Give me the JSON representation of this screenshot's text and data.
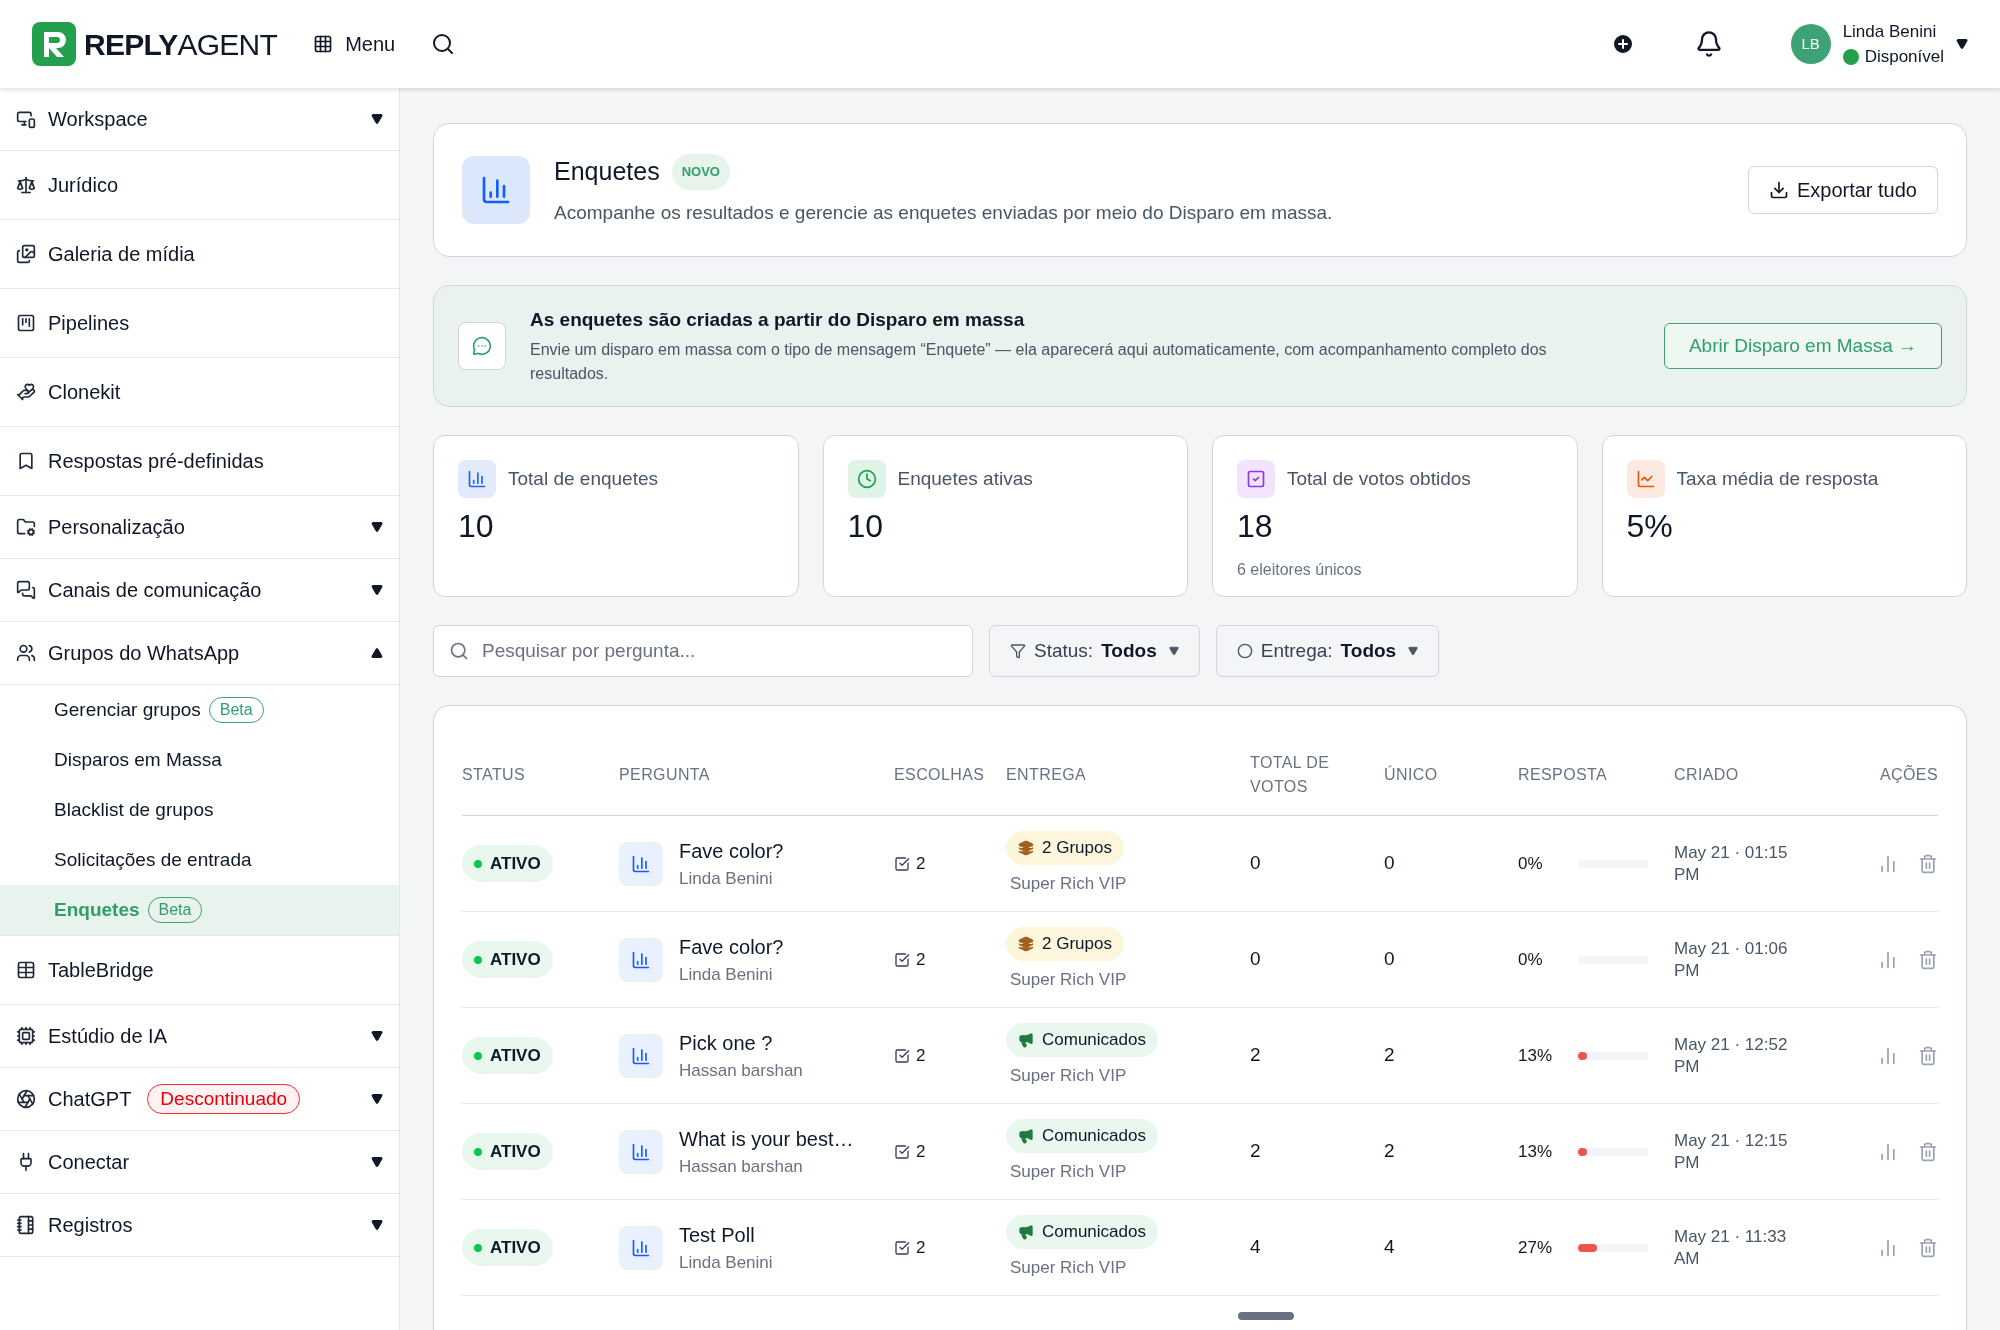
{
  "topbar": {
    "logo_bold": "REPLY",
    "logo_light": "AGENT",
    "menu_label": "Menu",
    "user": {
      "initials": "LB",
      "name": "Linda Benini",
      "status": "Disponível",
      "online": true
    }
  },
  "sidebar": {
    "items": [
      {
        "label": "Workspace",
        "kind": "expandable",
        "expanded": false
      },
      {
        "label": "Jurídico",
        "kind": "item"
      },
      {
        "label": "Galeria de mídia",
        "kind": "item"
      },
      {
        "label": "Pipelines",
        "kind": "item"
      },
      {
        "label": "Clonekit",
        "kind": "item"
      },
      {
        "label": "Respostas pré-definidas",
        "kind": "item"
      },
      {
        "label": "Personalização",
        "kind": "expandable",
        "expanded": false
      },
      {
        "label": "Canais de comunicação",
        "kind": "expandable",
        "expanded": false
      },
      {
        "label": "Grupos do WhatsApp",
        "kind": "expandable",
        "expanded": true,
        "children": [
          {
            "label": "Gerenciar grupos",
            "badge": "Beta",
            "selected": false
          },
          {
            "label": "Disparos em Massa",
            "selected": false
          },
          {
            "label": "Blacklist de grupos",
            "selected": false
          },
          {
            "label": "Solicitações de entrada",
            "selected": false
          },
          {
            "label": "Enquetes",
            "badge": "Beta",
            "selected": true
          }
        ]
      },
      {
        "label": "TableBridge",
        "kind": "item"
      },
      {
        "label": "Estúdio de IA",
        "kind": "expandable",
        "expanded": false
      },
      {
        "label": "ChatGPT",
        "kind": "expandable",
        "expanded": false,
        "badge": "Descontinuado"
      },
      {
        "label": "Conectar",
        "kind": "expandable",
        "expanded": false
      },
      {
        "label": "Registros",
        "kind": "expandable",
        "expanded": false
      }
    ]
  },
  "page_header": {
    "title": "Enquetes",
    "badge": "NOVO",
    "subtitle": "Acompanhe os resultados e gerencie as enquetes enviadas por meio do Disparo em massa.",
    "export_button": "Exportar tudo"
  },
  "info_banner": {
    "title": "As enquetes são criadas a partir do Disparo em massa",
    "text": "Envie um disparo em massa com o tipo de mensagem “Enquete” — ela aparecerá aqui automaticamente, com acompanhamento completo dos resultados.",
    "button": "Abrir Disparo em Massa →"
  },
  "stats": [
    {
      "label": "Total de enquetes",
      "value": "10",
      "color": "#2563eb"
    },
    {
      "label": "Enquetes ativas",
      "value": "10",
      "color": "#16a34a"
    },
    {
      "label": "Total de votos obtidos",
      "value": "18",
      "note": "6 eleitores únicos",
      "color": "#9333ea"
    },
    {
      "label": "Taxa média de resposta",
      "value": "5%",
      "color": "#ea580c"
    }
  ],
  "filters": {
    "search": {
      "placeholder": "Pesquisar por pergunta..."
    },
    "status": {
      "label": "Status:",
      "value": "Todos"
    },
    "delivery": {
      "label": "Entrega:",
      "value": "Todos"
    }
  },
  "table": {
    "columns": [
      "STATUS",
      "PERGUNTA",
      "ESCOLHAS",
      "ENTREGA",
      "TOTAL DE VOTOS",
      "ÚNICO",
      "RESPOSTA",
      "CRIADO",
      "AÇÕES"
    ],
    "rows": [
      {
        "status": "ATIVO",
        "question": "Fave color?",
        "author": "Linda Benini",
        "choices": "2",
        "delivery": {
          "kind": "groups",
          "label": "2 Grupos"
        },
        "target": "Super Rich VIP",
        "votes": "0",
        "unique": "0",
        "response": "0%",
        "level": 0,
        "created": "May 21 · 01:15 PM"
      },
      {
        "status": "ATIVO",
        "question": "Fave color?",
        "author": "Linda Benini",
        "choices": "2",
        "delivery": {
          "kind": "groups",
          "label": "2 Grupos"
        },
        "target": "Super Rich VIP",
        "votes": "0",
        "unique": "0",
        "response": "0%",
        "level": 0,
        "created": "May 21 · 01:06 PM"
      },
      {
        "status": "ATIVO",
        "question": "Pick one ?",
        "author": "Hassan barshan",
        "choices": "2",
        "delivery": {
          "kind": "announcements",
          "label": "Comunicados"
        },
        "target": "Super Rich VIP",
        "votes": "2",
        "unique": "2",
        "response": "13%",
        "level": 0.13,
        "created": "May 21 · 12:52 PM"
      },
      {
        "status": "ATIVO",
        "question": "What is your best…",
        "author": "Hassan barshan",
        "choices": "2",
        "delivery": {
          "kind": "announcements",
          "label": "Comunicados"
        },
        "target": "Super Rich VIP",
        "votes": "2",
        "unique": "2",
        "response": "13%",
        "level": 0.13,
        "created": "May 21 · 12:15 PM"
      },
      {
        "status": "ATIVO",
        "question": "Test Poll",
        "author": "Linda Benini",
        "choices": "2",
        "delivery": {
          "kind": "announcements",
          "label": "Comunicados"
        },
        "target": "Super Rich VIP",
        "votes": "4",
        "unique": "4",
        "response": "27%",
        "level": 0.27,
        "created": "May 21 · 11:33 AM"
      }
    ]
  }
}
